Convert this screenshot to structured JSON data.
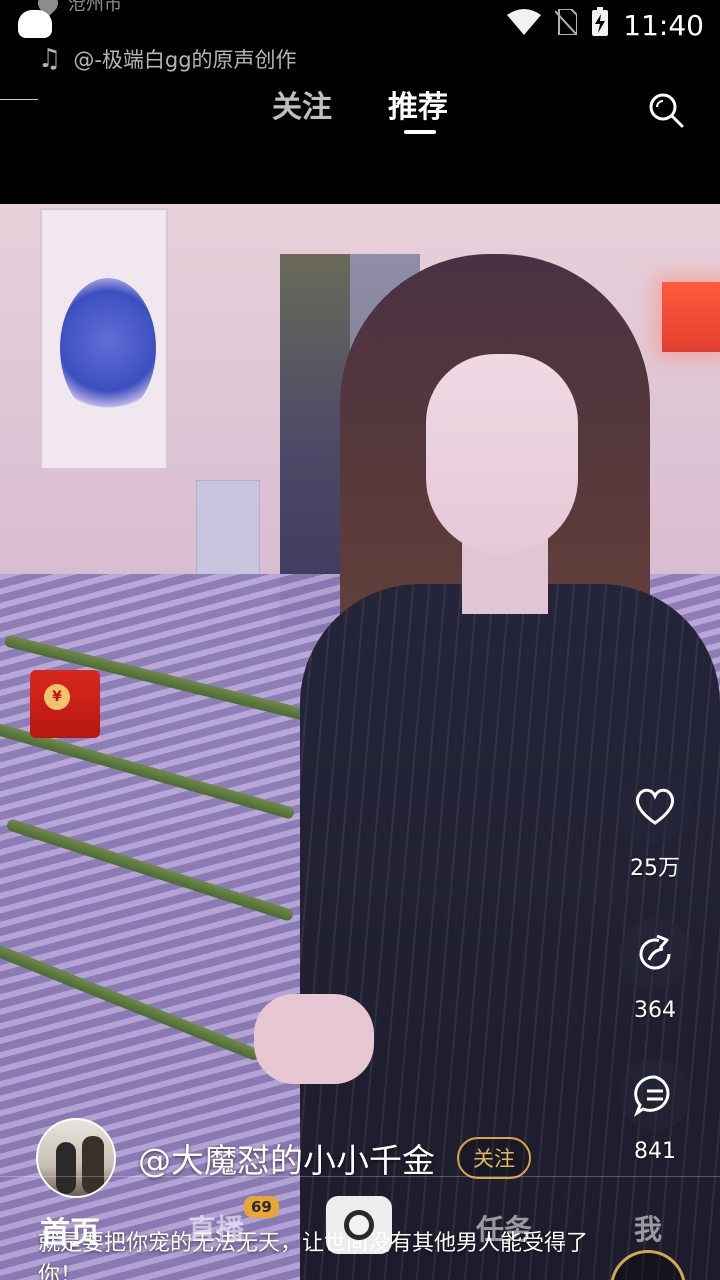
{
  "status_bar": {
    "time": "11:40"
  },
  "location": {
    "city": "沧州市"
  },
  "music": {
    "label": "@-极端白gg的原声创作"
  },
  "top_tabs": [
    {
      "label": "关注",
      "active": false
    },
    {
      "label": "推荐",
      "active": true
    }
  ],
  "actions": {
    "like_count": "25万",
    "share_count": "364",
    "comment_count": "841"
  },
  "author": {
    "name": "@大魔怼的小小千金",
    "follow_label": "关注"
  },
  "caption": {
    "text": "就是要把你宠的无法无天，让世间没有其他男人能受得了你！"
  },
  "redpacket": {
    "symbol": "¥"
  },
  "bottom_nav": {
    "home": "首页",
    "live": "直播",
    "live_badge": "69",
    "task": "任务",
    "me": "我"
  },
  "colors": {
    "follow_gold": "#d9a54a",
    "badge": "#e8a635"
  }
}
